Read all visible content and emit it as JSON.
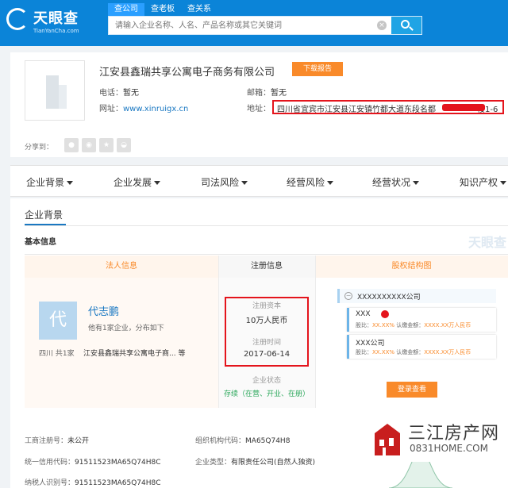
{
  "header": {
    "logo_title": "天眼查",
    "logo_sub": "TianYanCha.com",
    "tabs": [
      "查公司",
      "查老板",
      "查关系"
    ],
    "search_placeholder": "请输入企业名称、人名、产品名称或其它关键词"
  },
  "company": {
    "name": "江安县鑫瑞共享公寓电子商务有限公司",
    "report_btn": "下载报告",
    "phone_label": "电话：",
    "phone": "暂无",
    "email_label": "邮箱：",
    "email": "暂无",
    "web_label": "网址：",
    "web": "www.xinruigx.cn",
    "addr_label": "地址：",
    "addr": "四川省宜宾市江安县江安镇竹都大道东段名都",
    "addr_tail": "楼1-6",
    "share_label": "分享到："
  },
  "nav": [
    "企业背景",
    "企业发展",
    "司法风险",
    "经营风险",
    "经营状况",
    "知识产权"
  ],
  "section": {
    "title": "企业背景",
    "basic": "基本信息",
    "watermark": "天眼查"
  },
  "table": {
    "headers": [
      "法人信息",
      "注册信息",
      "股权结构图"
    ],
    "legal": {
      "avatar": "代",
      "name": "代志鹏",
      "desc": "他有1家企业，分布如下",
      "prov": "四川  共1家",
      "comp": "江安县鑫瑞共享公寓电子商...  等"
    },
    "reg": {
      "capital_label": "注册资本",
      "capital": "10万人民币",
      "time_label": "注册时间",
      "time": "2017-06-14",
      "status_label": "企业状态",
      "status": "存续（在营、开业、在册）"
    },
    "equity": {
      "root": "XXXXXXXXXX公司",
      "nodes": [
        {
          "name": "XXX",
          "ratio_label": "股比：",
          "ratio": "XX.XX%",
          "amt_label": "认缴金额：",
          "amt": "XXXX.XX万人民币"
        },
        {
          "name": "XXX公司",
          "ratio_label": "股比：",
          "ratio": "XX.XX%",
          "amt_label": "认缴金额：",
          "amt": "XXXX.XX万人民币"
        }
      ],
      "login": "登录查看"
    }
  },
  "info": {
    "regno_label": "工商注册号：",
    "regno": "未公开",
    "orgcode_label": "组织机构代码：",
    "orgcode": "MA65Q74H8",
    "credit_label": "统一信用代码：",
    "credit": "91511523MA65Q74H8C",
    "type_label": "企业类型：",
    "type": "有限责任公司(自然人独资)",
    "tax_label": "纳税人识别号：",
    "tax": "91511523MA65Q74H8C"
  },
  "brand": {
    "name": "三江房产网",
    "url": "0831HOME.COM"
  },
  "colors": {
    "brand_blue": "#0b84d8",
    "accent_orange": "#f98a2a",
    "highlight_red": "#e4141c",
    "status_green": "#2aa75a"
  }
}
